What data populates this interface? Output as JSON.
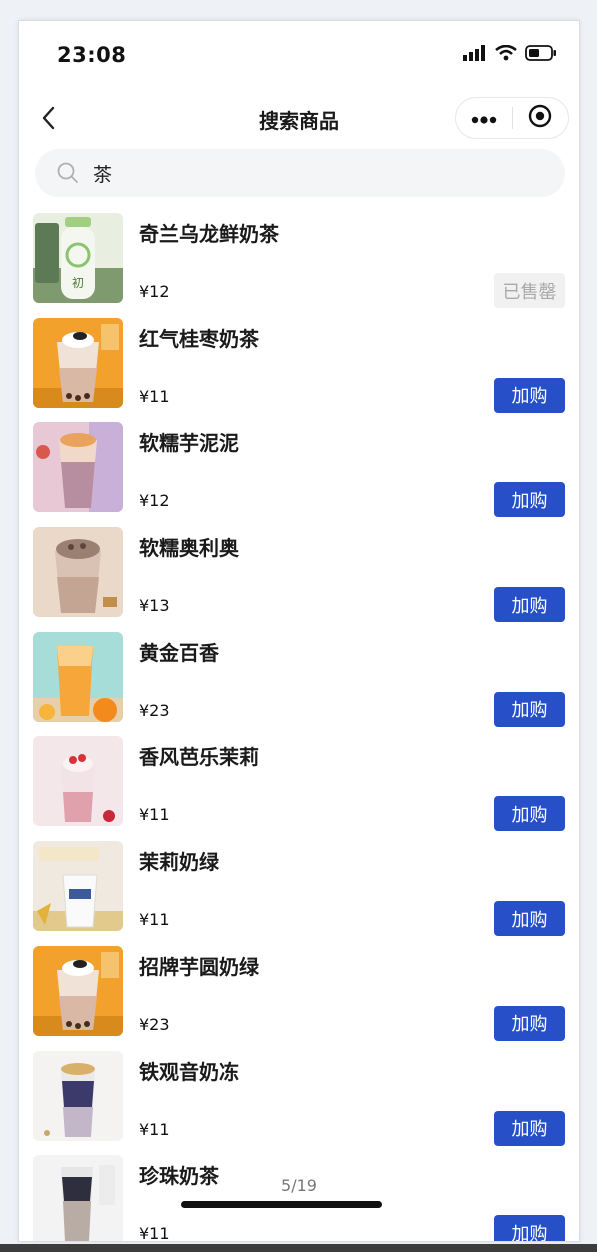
{
  "status_bar": {
    "time": "23:08",
    "icons": [
      "signal-icon",
      "wifi-icon",
      "battery-icon"
    ]
  },
  "nav": {
    "title": "搜索商品",
    "back_icon": "chevron-left-icon",
    "more_icon": "more-dots-icon",
    "close_icon": "target-circle-icon"
  },
  "search": {
    "icon": "search-icon",
    "value": "茶"
  },
  "products": [
    {
      "name": "奇兰乌龙鲜奶茶",
      "price": "¥12",
      "action": "已售罄",
      "action_type": "sold"
    },
    {
      "name": "红气桂枣奶茶",
      "price": "¥11",
      "action": "加购",
      "action_type": "buy"
    },
    {
      "name": "软糯芋泥泥",
      "price": "¥12",
      "action": "加购",
      "action_type": "buy"
    },
    {
      "name": "软糯奥利奥",
      "price": "¥13",
      "action": "加购",
      "action_type": "buy"
    },
    {
      "name": "黄金百香",
      "price": "¥23",
      "action": "加购",
      "action_type": "buy"
    },
    {
      "name": "香风芭乐茉莉",
      "price": "¥11",
      "action": "加购",
      "action_type": "buy"
    },
    {
      "name": "茉莉奶绿",
      "price": "¥11",
      "action": "加购",
      "action_type": "buy"
    },
    {
      "name": "招牌芋圆奶绿",
      "price": "¥23",
      "action": "加购",
      "action_type": "buy"
    },
    {
      "name": "铁观音奶冻",
      "price": "¥11",
      "action": "加购",
      "action_type": "buy"
    },
    {
      "name": "珍珠奶茶",
      "price": "¥11",
      "action": "加购",
      "action_type": "buy"
    }
  ],
  "page_indicator": "5/19",
  "colors": {
    "accent": "#2750c8",
    "sold_bg": "#f1f1f1",
    "sold_text": "#a9a9a9"
  }
}
